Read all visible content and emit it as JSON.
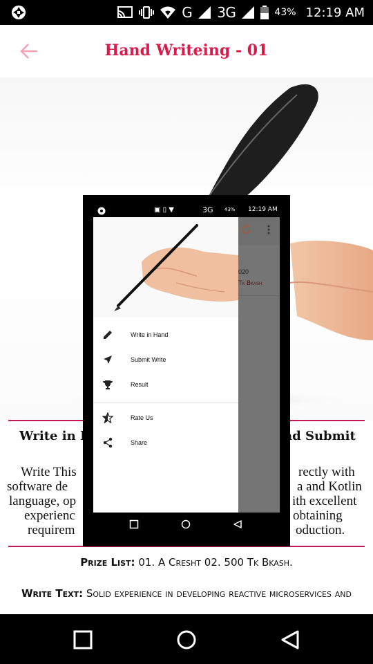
{
  "status_bar": {
    "network_label": "G",
    "network_3g": "3G",
    "battery": "43%",
    "time": "12:19 AM"
  },
  "app_bar": {
    "title": "Hand Writeing - 01",
    "back_icon": "arrow-back-icon"
  },
  "info": {
    "heading_left": "Write in H",
    "heading_right": "nd Submit",
    "body_lines": [
      [
        "Write This",
        "rectly with"
      ],
      [
        "software de",
        "a and Kotlin"
      ],
      [
        "language, op",
        "ith excellent"
      ],
      [
        "experienc",
        "obtaining"
      ],
      [
        "requirem",
        "oduction."
      ]
    ],
    "prize_label": "Prize List:",
    "prize_value": " 01. A Cresht 02. 500 Tk Bkash.",
    "write_label": "Write Text:",
    "write_value": " Solid experience in developing reactive microservices and"
  },
  "overlay": {
    "status_battery": "43%",
    "status_time": "12:19 AM",
    "status_3g": "3G",
    "bg_date_partial": "020",
    "bg_prize_partial": "Tk Bkash",
    "drawer_items": [
      {
        "label": "Write in Hand",
        "icon": "pencil-icon"
      },
      {
        "label": "Submit Write",
        "icon": "send-icon"
      },
      {
        "label": "Result",
        "icon": "trophy-icon"
      },
      {
        "label": "Rate Us",
        "icon": "star-half-icon"
      },
      {
        "label": "Share",
        "icon": "share-icon"
      }
    ]
  },
  "colors": {
    "accent": "#d81b4a",
    "divider": "#c2185b",
    "back_arrow": "#f7a1b4"
  }
}
